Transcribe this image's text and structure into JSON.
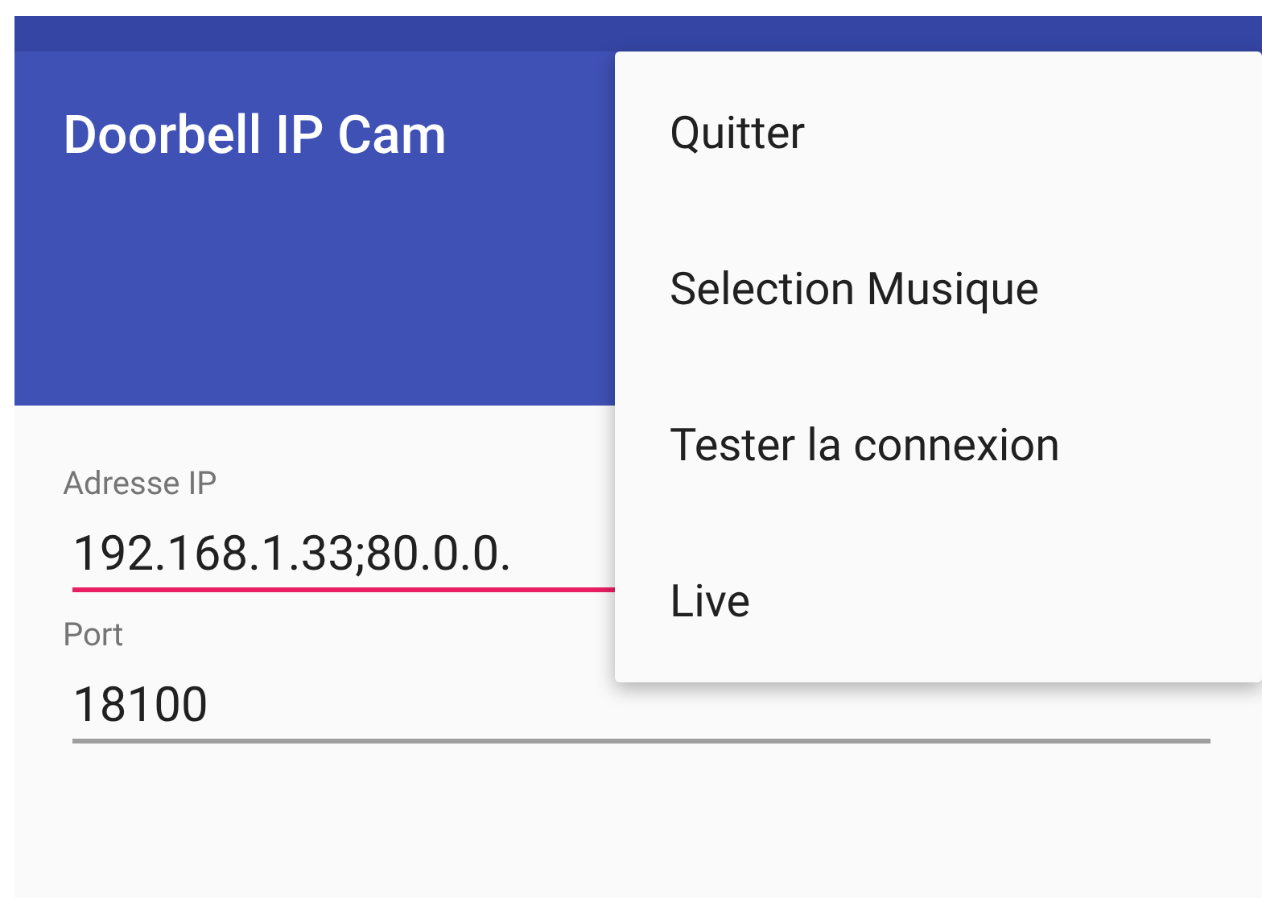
{
  "toolbar": {
    "title": "Doorbell IP Cam"
  },
  "fields": [
    {
      "label": "Adresse IP",
      "value": "192.168.1.33;80.0.0.",
      "focused": true
    },
    {
      "label": "Port",
      "value": "18100",
      "focused": false
    }
  ],
  "menu": {
    "items": [
      {
        "label": "Quitter"
      },
      {
        "label": "Selection Musique"
      },
      {
        "label": "Tester la connexion"
      },
      {
        "label": "Live"
      }
    ]
  }
}
